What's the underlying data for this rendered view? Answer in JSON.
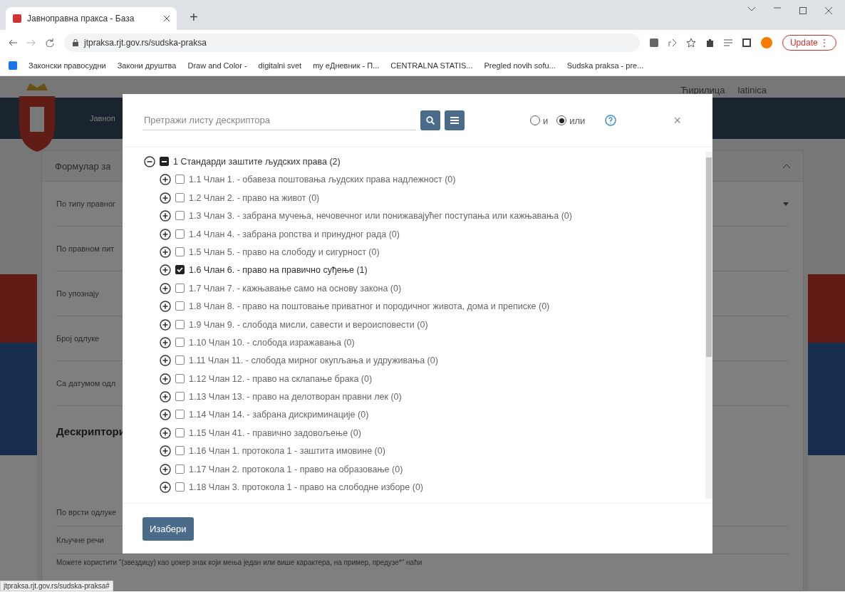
{
  "browser": {
    "tab_title": "Јавноправна пракса - База",
    "new_tab": "+",
    "url": "jtpraksa.rjt.gov.rs/sudska-praksa",
    "update_button": "Update",
    "update_menu": "⋮",
    "bookmarks": [
      "Законски правосудни",
      "Закони друштва",
      "Draw and Color -",
      "digitalni svet",
      "my eДневник - П...",
      "CENTRALNA STATIS...",
      "Pregled novih sofu...",
      "Sudska praksa - pre..."
    ]
  },
  "page": {
    "lang_links": [
      "Ћирилица",
      "latinica"
    ],
    "site_title": "Јавноп",
    "form_title": "Формулар за",
    "fields": [
      "По типу правног",
      "По правном пит",
      "По упознају",
      "Број одлуке",
      "Са датумом одл"
    ],
    "section_heading": "Дескриптори",
    "decision_type_label": "По врсти одлуке",
    "keywords_label": "Кључне речи",
    "help_text": "Можете користити \"(звездицу) као џокер знак који мења један или више карактера, на пример, предузе*\" наћи",
    "status_url": "jtpraksa.rjt.gov.rs/sudska-praksa#"
  },
  "modal": {
    "search_placeholder": "Претражи листу дескриптора",
    "logic_options": [
      {
        "label": "и",
        "selected": false
      },
      {
        "label": "или",
        "selected": true
      }
    ],
    "close": "×",
    "tree": {
      "label": "1 Стандарди заштите људских права (2)",
      "expanded": true,
      "indeterminate": true,
      "children": [
        {
          "label": "1.1 Члан 1. - обавеза поштовања људских права надлежност (0)",
          "expanded": false,
          "checked": false
        },
        {
          "label": "1.2 Члан 2. - право на живот (0)",
          "expanded": false,
          "checked": false
        },
        {
          "label": "1.3 Члан 3. - забрана мучења, нечовечног или понижавајућег поступања или кажњавања (0)",
          "expanded": false,
          "checked": false
        },
        {
          "label": "1.4 Члан 4. - забрана ропства и принудног рада (0)",
          "expanded": false,
          "checked": false
        },
        {
          "label": "1.5 Члан 5. - право на слободу и сигурност (0)",
          "expanded": false,
          "checked": false
        },
        {
          "label": "1.6 Члан 6. - право на правично суђење (1)",
          "expanded": false,
          "checked": true
        },
        {
          "label": "1.7 Члан 7. - кажњавање само на основу закона (0)",
          "expanded": false,
          "checked": false
        },
        {
          "label": "1.8 Члан 8. - право на поштовање приватног и породичног живота, дома и преписке (0)",
          "expanded": false,
          "checked": false
        },
        {
          "label": "1.9 Члан 9. - слобода мисли, савести и вероисповести (0)",
          "expanded": false,
          "checked": false
        },
        {
          "label": "1.10 Члан 10. - слобода изражавања (0)",
          "expanded": false,
          "checked": false
        },
        {
          "label": "1.11 Члан 11. - слобода мирног окупљања и удруживања (0)",
          "expanded": false,
          "checked": false
        },
        {
          "label": "1.12 Члан 12. - право на склапање брака (0)",
          "expanded": false,
          "checked": false
        },
        {
          "label": "1.13 Члан 13. - право на делотворан правни лек (0)",
          "expanded": false,
          "checked": false
        },
        {
          "label": "1.14 Члан 14. - забрана дискриминације (0)",
          "expanded": false,
          "checked": false
        },
        {
          "label": "1.15 Члан 41. - правично задовољење (0)",
          "expanded": false,
          "checked": false
        },
        {
          "label": "1.16 Члан 1. протокола 1 - заштита имовине (0)",
          "expanded": false,
          "checked": false
        },
        {
          "label": "1.17 Члан 2. протокола 1 - право на образовање (0)",
          "expanded": false,
          "checked": false
        },
        {
          "label": "1.18 Члан 3. протокола 1 - право на слободне изборе (0)",
          "expanded": false,
          "checked": false
        }
      ]
    },
    "select_button": "Изабери"
  }
}
